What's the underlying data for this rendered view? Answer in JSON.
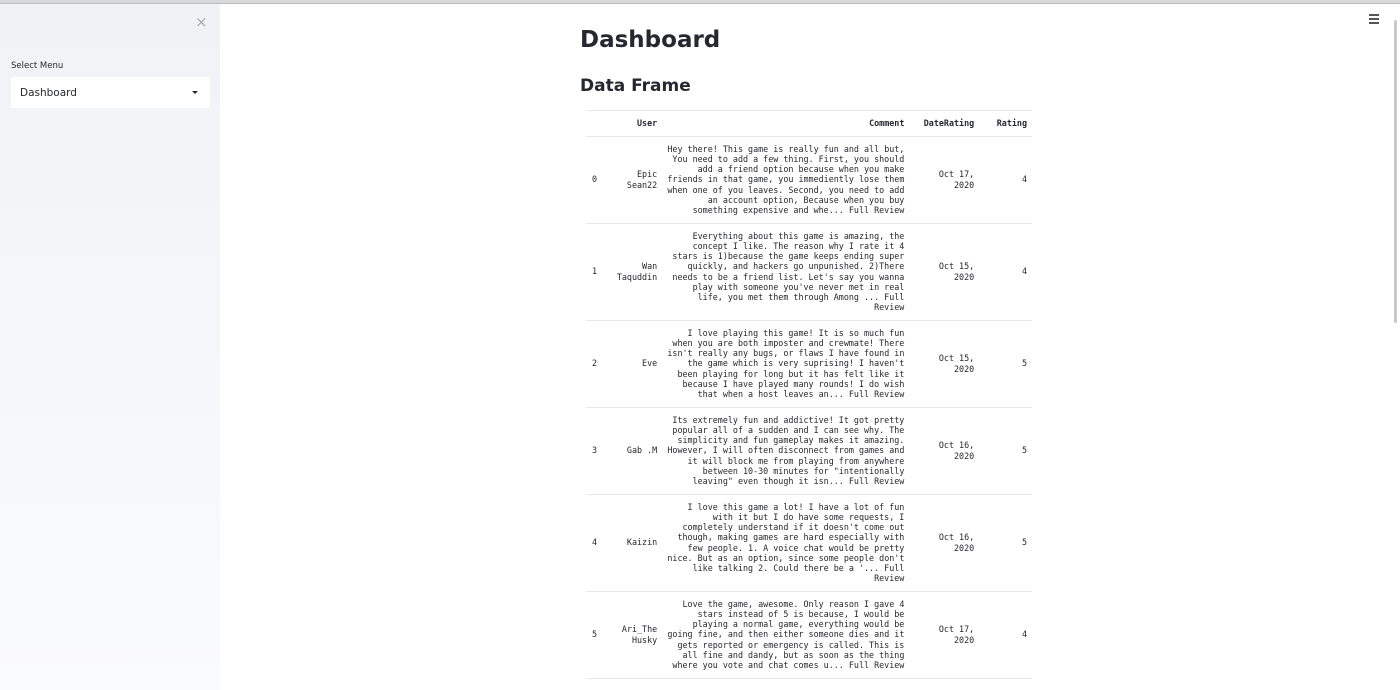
{
  "sidebar": {
    "close_label": "×",
    "menu_label": "Select Menu",
    "menu_selected": "Dashboard"
  },
  "main": {
    "title": "Dashboard",
    "section_title": "Data Frame"
  },
  "table": {
    "columns": [
      "",
      "User",
      "Comment",
      "DateRating",
      "Rating"
    ],
    "rows": [
      {
        "index": "0",
        "user": "Epic Sean22",
        "comment": "Hey there! This game is really fun and all but, You need to add a few thing. First, you should add a friend option because when you make friends in that game, you immediently lose them when one of you leaves. Second, you need to add an account option, Because when you buy something expensive and whe... Full Review",
        "date": "Oct 17, 2020",
        "rating": "4"
      },
      {
        "index": "1",
        "user": "Wan Taquddin",
        "comment": "Everything about this game is amazing, the concept I like. The reason why I rate it 4 stars is 1)because the game keeps ending super quickly, and hackers go unpunished. 2)There needs to be a friend list. Let's say you wanna play with someone you've never met in real life, you met them through Among ... Full Review",
        "date": "Oct 15, 2020",
        "rating": "4"
      },
      {
        "index": "2",
        "user": "Eve",
        "comment": "I love playing this game! It is so much fun when you are both imposter and crewmate! There isn't really any bugs, or flaws I have found in the game which is very suprising! I haven't been playing for long but it has felt like it because I have played many rounds! I do wish that when a host leaves an... Full Review",
        "date": "Oct 15, 2020",
        "rating": "5"
      },
      {
        "index": "3",
        "user": "Gab .M",
        "comment": "Its extremely fun and addictive! It got pretty popular all of a sudden and I can see why. The simplicity and fun gameplay makes it amazing. However, I will often disconnect from games and it will block me from playing from anywhere between 10-30 minutes for \"intentionally leaving\" even though it isn... Full Review",
        "date": "Oct 16, 2020",
        "rating": "5"
      },
      {
        "index": "4",
        "user": "Kaizin",
        "comment": "I love this game a lot! I have a lot of fun with it but I do have some requests, I completely understand if it doesn't come out though, making games are hard especially with few people. 1. A voice chat would be pretty nice. But as an option, since some people don't like talking 2. Could there be a '... Full Review",
        "date": "Oct 16, 2020",
        "rating": "5"
      },
      {
        "index": "5",
        "user": "Ari_The Husky",
        "comment": "Love the game, awesome. Only reason I gave 4 stars instead of 5 is because, I would be playing a normal game, everything would be going fine, and then either someone dies and it gets reported or emergency is called. This is all fine and dandy, but as soon as the thing where you vote and chat comes u... Full Review",
        "date": "Oct 17, 2020",
        "rating": "4"
      }
    ]
  },
  "icons": {
    "close": "close-icon",
    "caret": "chevron-down-icon",
    "menu": "hamburger-menu-icon"
  }
}
